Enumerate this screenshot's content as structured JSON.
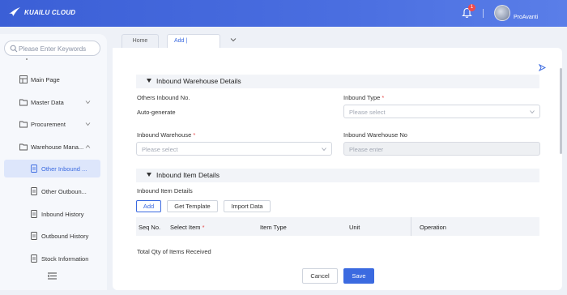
{
  "header": {
    "brand": "KUAILU CLOUD",
    "notification_count": "1",
    "username": "ProAvanti",
    "colors": {
      "brand_blue": "#3b5fd6",
      "badge_red": "#f04b4b"
    }
  },
  "sidebar": {
    "search_placeholder": "Please Enter Keywords",
    "items": [
      {
        "label": "Main Page",
        "icon": "grid-icon"
      },
      {
        "label": "Master Data",
        "icon": "folder-icon"
      },
      {
        "label": "Procurement",
        "icon": "folder-icon"
      },
      {
        "label": "Warehouse Mana...",
        "icon": "folder-icon"
      }
    ],
    "sub_items": [
      {
        "label": "Other Inbound ...",
        "icon": "document-icon",
        "active": true
      },
      {
        "label": "Other Outboun...",
        "icon": "document-icon"
      },
      {
        "label": "Inbound History",
        "icon": "document-icon"
      },
      {
        "label": "Outbound History",
        "icon": "document-icon"
      },
      {
        "label": "Stock Information",
        "icon": "document-icon"
      }
    ]
  },
  "tabs": [
    {
      "label": "Home"
    },
    {
      "label": "Add | Inbo...",
      "active": true
    }
  ],
  "form": {
    "section1_title": "Inbound Warehouse Details",
    "others_inbound_no_label": "Others Inbound No.",
    "others_inbound_no_value": "Auto-generate",
    "inbound_type_label": "Inbound Type",
    "inbound_type_placeholder": "Please select",
    "inbound_warehouse_label": "Inbound Warehouse",
    "inbound_warehouse_placeholder": "Please select",
    "inbound_warehouse_no_label": "Inbound Warehouse No",
    "inbound_warehouse_no_placeholder": "Please enter",
    "required_mark": "*",
    "section2_title": "Inbound Item Details",
    "item_details_label": "Inbound Item Details",
    "add_button": "Add",
    "get_template_button": "Get Template",
    "import_button": "Import Data",
    "table_columns": [
      "Seq No.",
      "Select Item",
      "Item Type",
      "Unit",
      "Operation"
    ],
    "total_label": "Total Qty of Items Received",
    "cancel_button": "Cancel",
    "save_button": "Save"
  }
}
